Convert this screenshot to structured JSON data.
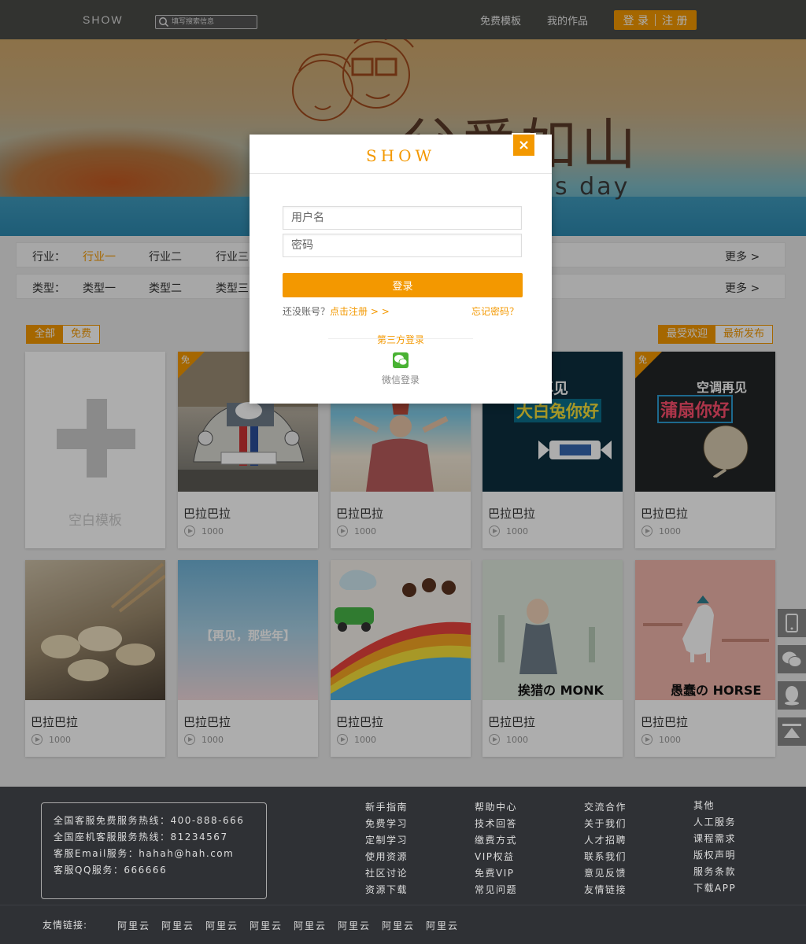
{
  "header": {
    "logo": "SHOW",
    "search_placeholder": "填写搜索信息",
    "nav": [
      "免费模板",
      "我的作品"
    ],
    "login": "登 录",
    "register": "注 册"
  },
  "banner": {
    "title": "父爱如山",
    "subtitle": "s day"
  },
  "filters": [
    {
      "label": "行业：",
      "options": [
        "行业一",
        "行业二",
        "行业三"
      ],
      "active": 0,
      "more": "更多 >"
    },
    {
      "label": "类型：",
      "options": [
        "类型一",
        "类型二",
        "类型三"
      ],
      "active": -1,
      "more": "更多 >"
    }
  ],
  "tabs_left": [
    "全部",
    "免费"
  ],
  "tabs_right": [
    "最受欢迎",
    "最新发布"
  ],
  "blank_card": "空白模板",
  "cards": [
    {
      "title": "巴拉巴拉",
      "views": "1000",
      "free": true,
      "free_label": "免"
    },
    {
      "title": "巴拉巴拉",
      "views": "1000",
      "free": false
    },
    {
      "title": "巴拉巴拉",
      "views": "1000",
      "free": false,
      "thumb_text": "巧克力再见",
      "thumb_sub": "大白兔你好"
    },
    {
      "title": "巴拉巴拉",
      "views": "1000",
      "free": true,
      "free_label": "免",
      "thumb_text": "空调再见",
      "thumb_sub": "蒲扇你好"
    },
    {
      "title": "巴拉巴拉",
      "views": "1000",
      "free": false
    },
    {
      "title": "巴拉巴拉",
      "views": "1000",
      "free": false,
      "thumb_text": "【再见，那些年】"
    },
    {
      "title": "巴拉巴拉",
      "views": "1000",
      "free": false
    },
    {
      "title": "巴拉巴拉",
      "views": "1000",
      "free": false,
      "thumb_text": "挨猎の MONK"
    },
    {
      "title": "巴拉巴拉",
      "views": "1000",
      "free": false,
      "thumb_text": "愚蠢の HORSE"
    }
  ],
  "modal": {
    "logo": "SHOW",
    "close": "×",
    "username_placeholder": "用户名",
    "password_placeholder": "密码",
    "login_button": "登录",
    "no_account": "还没账号？",
    "register_link": "点击注册 > >",
    "forgot": "忘记密码？",
    "third_party": "第三方登录",
    "wechat_login": "微信登录"
  },
  "footer": {
    "contact": [
      "全国客服免费服务热线：400-888-666",
      "全国座机客服服务热线：81234567",
      "客服Email服务：hahah@hah.com",
      "客服QQ服务：666666"
    ],
    "columns": [
      [
        "新手指南",
        "免费学习",
        "定制学习",
        "使用资源",
        "社区讨论",
        "资源下载"
      ],
      [
        "帮助中心",
        "技术回答",
        "缴费方式",
        "VIP权益",
        "免费VIP",
        "常见问题"
      ],
      [
        "交流合作",
        "关于我们",
        "人才招聘",
        "联系我们",
        "意见反馈",
        "友情链接"
      ],
      [
        "其他",
        "人工服务",
        "课程需求",
        "版权声明",
        "服务条款",
        "下载APP"
      ]
    ],
    "friends_label": "友情链接:",
    "friends": [
      "阿里云",
      "阿里云",
      "阿里云",
      "阿里云",
      "阿里云",
      "阿里云",
      "阿里云",
      "阿里云"
    ]
  },
  "colors": {
    "accent": "#f39800",
    "footer_bg": "#2f3135",
    "header_bg": "#4a4c48"
  }
}
